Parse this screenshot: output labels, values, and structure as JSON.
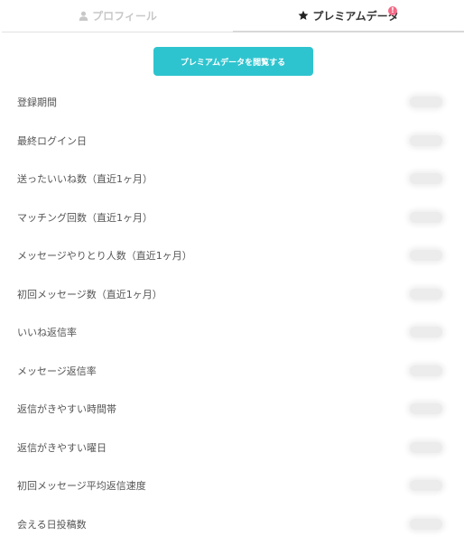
{
  "tabs": [
    {
      "label": "プロフィール",
      "icon": "person-icon",
      "active": false
    },
    {
      "label": "プレミアムデータ",
      "icon": "star-icon",
      "active": true,
      "badge": "!"
    }
  ],
  "cta_label": "プレミアムデータを閲覧する",
  "colors": {
    "accent": "#2ec4cf",
    "badge": "#f46a86"
  },
  "rows": [
    {
      "label": "登録期間"
    },
    {
      "label": "最終ログイン日"
    },
    {
      "label": "送ったいいね数（直近1ヶ月）"
    },
    {
      "label": "マッチング回数（直近1ヶ月）"
    },
    {
      "label": "メッセージやりとり人数（直近1ヶ月）"
    },
    {
      "label": "初回メッセージ数（直近1ヶ月）"
    },
    {
      "label": "いいね返信率"
    },
    {
      "label": "メッセージ返信率"
    },
    {
      "label": "返信がきやすい時間帯"
    },
    {
      "label": "返信がきやすい曜日"
    },
    {
      "label": "初回メッセージ平均返信速度"
    },
    {
      "label": "会える日投稿数"
    }
  ]
}
